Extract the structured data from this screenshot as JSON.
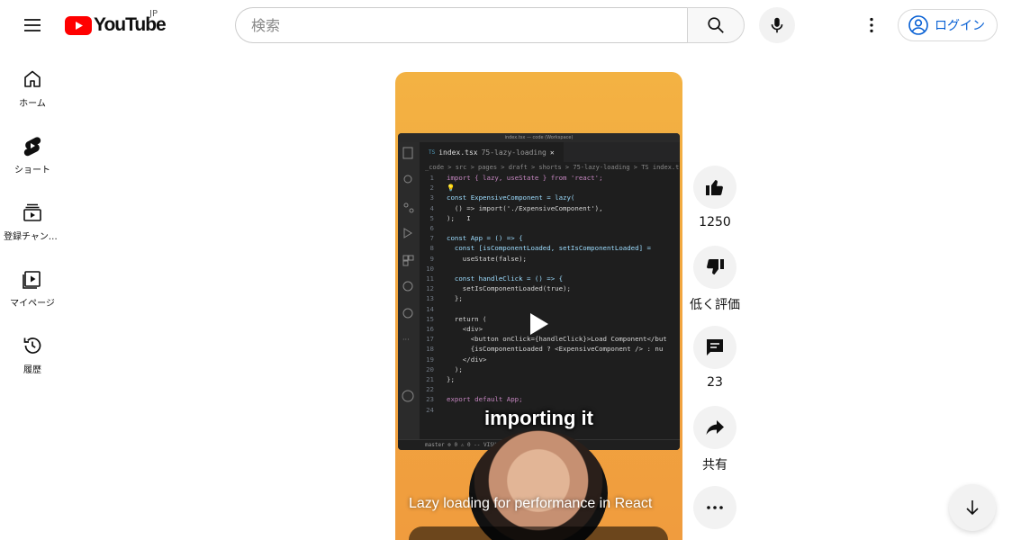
{
  "header": {
    "logo_text": "YouTube",
    "region": "JP",
    "search_placeholder": "検索",
    "login_label": "ログイン"
  },
  "sidebar": {
    "items": [
      {
        "label": "ホーム",
        "icon": "home-icon"
      },
      {
        "label": "ショート",
        "icon": "shorts-icon"
      },
      {
        "label": "登録チャンネル",
        "icon": "subscriptions-icon"
      },
      {
        "label": "マイページ",
        "icon": "library-icon"
      },
      {
        "label": "履歴",
        "icon": "history-icon"
      }
    ]
  },
  "video": {
    "editor_title": "index.tsx — code (Workspace)",
    "tab_file": "index.tsx",
    "tab_folder": "75-lazy-loading",
    "breadcrumb": "_code > src > pages > draft > shorts > 75-lazy-loading > TS index.tsx > ...",
    "status_bar": "master  ⊗ 0 ⚠ 0   -- VISUAL --",
    "code_lines": [
      {
        "n": "1",
        "t": "import { lazy, useState } from 'react';"
      },
      {
        "n": "2",
        "t": "💡"
      },
      {
        "n": "3",
        "t": "const ExpensiveComponent = lazy("
      },
      {
        "n": "4",
        "t": "  () => import('./ExpensiveComponent'),"
      },
      {
        "n": "5",
        "t": ");   I"
      },
      {
        "n": "6",
        "t": ""
      },
      {
        "n": "7",
        "t": "const App = () => {"
      },
      {
        "n": "8",
        "t": "  const [isComponentLoaded, setIsComponentLoaded] ="
      },
      {
        "n": "9",
        "t": "    useState(false);"
      },
      {
        "n": "10",
        "t": ""
      },
      {
        "n": "11",
        "t": "  const handleClick = () => {"
      },
      {
        "n": "12",
        "t": "    setIsComponentLoaded(true);"
      },
      {
        "n": "13",
        "t": "  };"
      },
      {
        "n": "14",
        "t": ""
      },
      {
        "n": "15",
        "t": "  return ("
      },
      {
        "n": "16",
        "t": "    <div>"
      },
      {
        "n": "17",
        "t": "      <button onClick={handleClick}>Load Component</but"
      },
      {
        "n": "18",
        "t": "      {isComponentLoaded ? <ExpensiveComponent /> : nu"
      },
      {
        "n": "19",
        "t": "    </div>"
      },
      {
        "n": "20",
        "t": "  );"
      },
      {
        "n": "21",
        "t": "};"
      },
      {
        "n": "22",
        "t": ""
      },
      {
        "n": "23",
        "t": "export default App;"
      },
      {
        "n": "24",
        "t": ""
      }
    ],
    "caption_word": "importing it",
    "title": "Lazy loading for performance in React"
  },
  "actions": {
    "like_count": "1250",
    "dislike_label": "低く評価",
    "comment_count": "23",
    "share_label": "共有"
  },
  "colors": {
    "brand_red": "#ff0000",
    "link_blue": "#065fd4",
    "button_bg": "#f2f2f2"
  }
}
